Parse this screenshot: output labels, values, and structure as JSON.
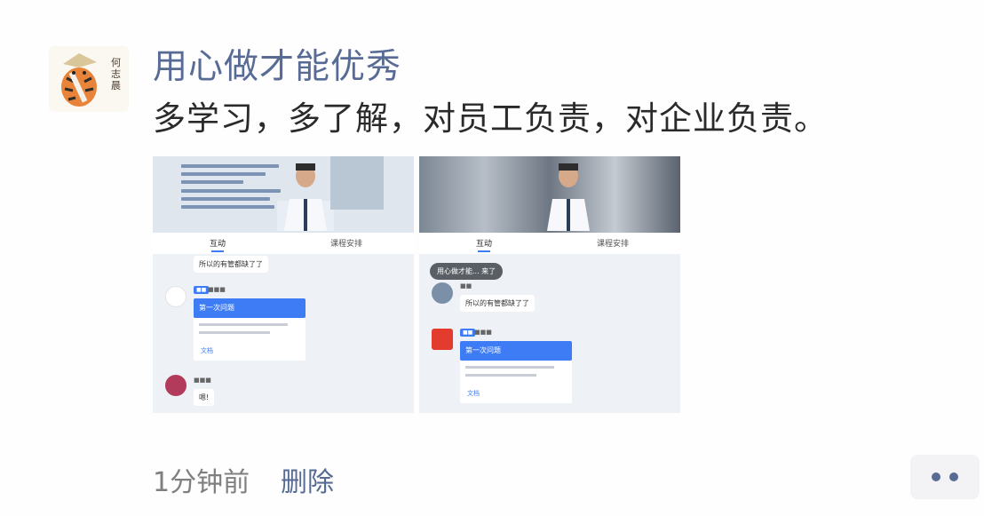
{
  "post": {
    "author": "用心做才能优秀",
    "text": "多学习，多了解，对员工负责，对企业负责。",
    "time": "1分钟前",
    "delete_label": "删除",
    "avatar": {
      "icon": "tiger-avatar-icon",
      "signature": "何志晨"
    }
  },
  "thumbnails": [
    {
      "tabs": {
        "active": "互动",
        "other": "课程安排"
      },
      "messages": {
        "chat_text": "所以的有管都缺了了",
        "card_title": "第一次问题",
        "file_label": "文档",
        "user_reply": "嗯!"
      }
    },
    {
      "tabs": {
        "active": "互动",
        "other": "课程安排"
      },
      "messages": {
        "toast": "用心做才能... 来了",
        "chat_text": "所以的有管都缺了了",
        "card_title": "第一次问题",
        "file_label": "文档"
      }
    }
  ],
  "actions": {
    "more_icon": "more-dots-icon"
  },
  "colors": {
    "link": "#576b95",
    "text": "#2a2a2a",
    "muted": "#7f7f7f",
    "accent": "#3d7cf4"
  }
}
